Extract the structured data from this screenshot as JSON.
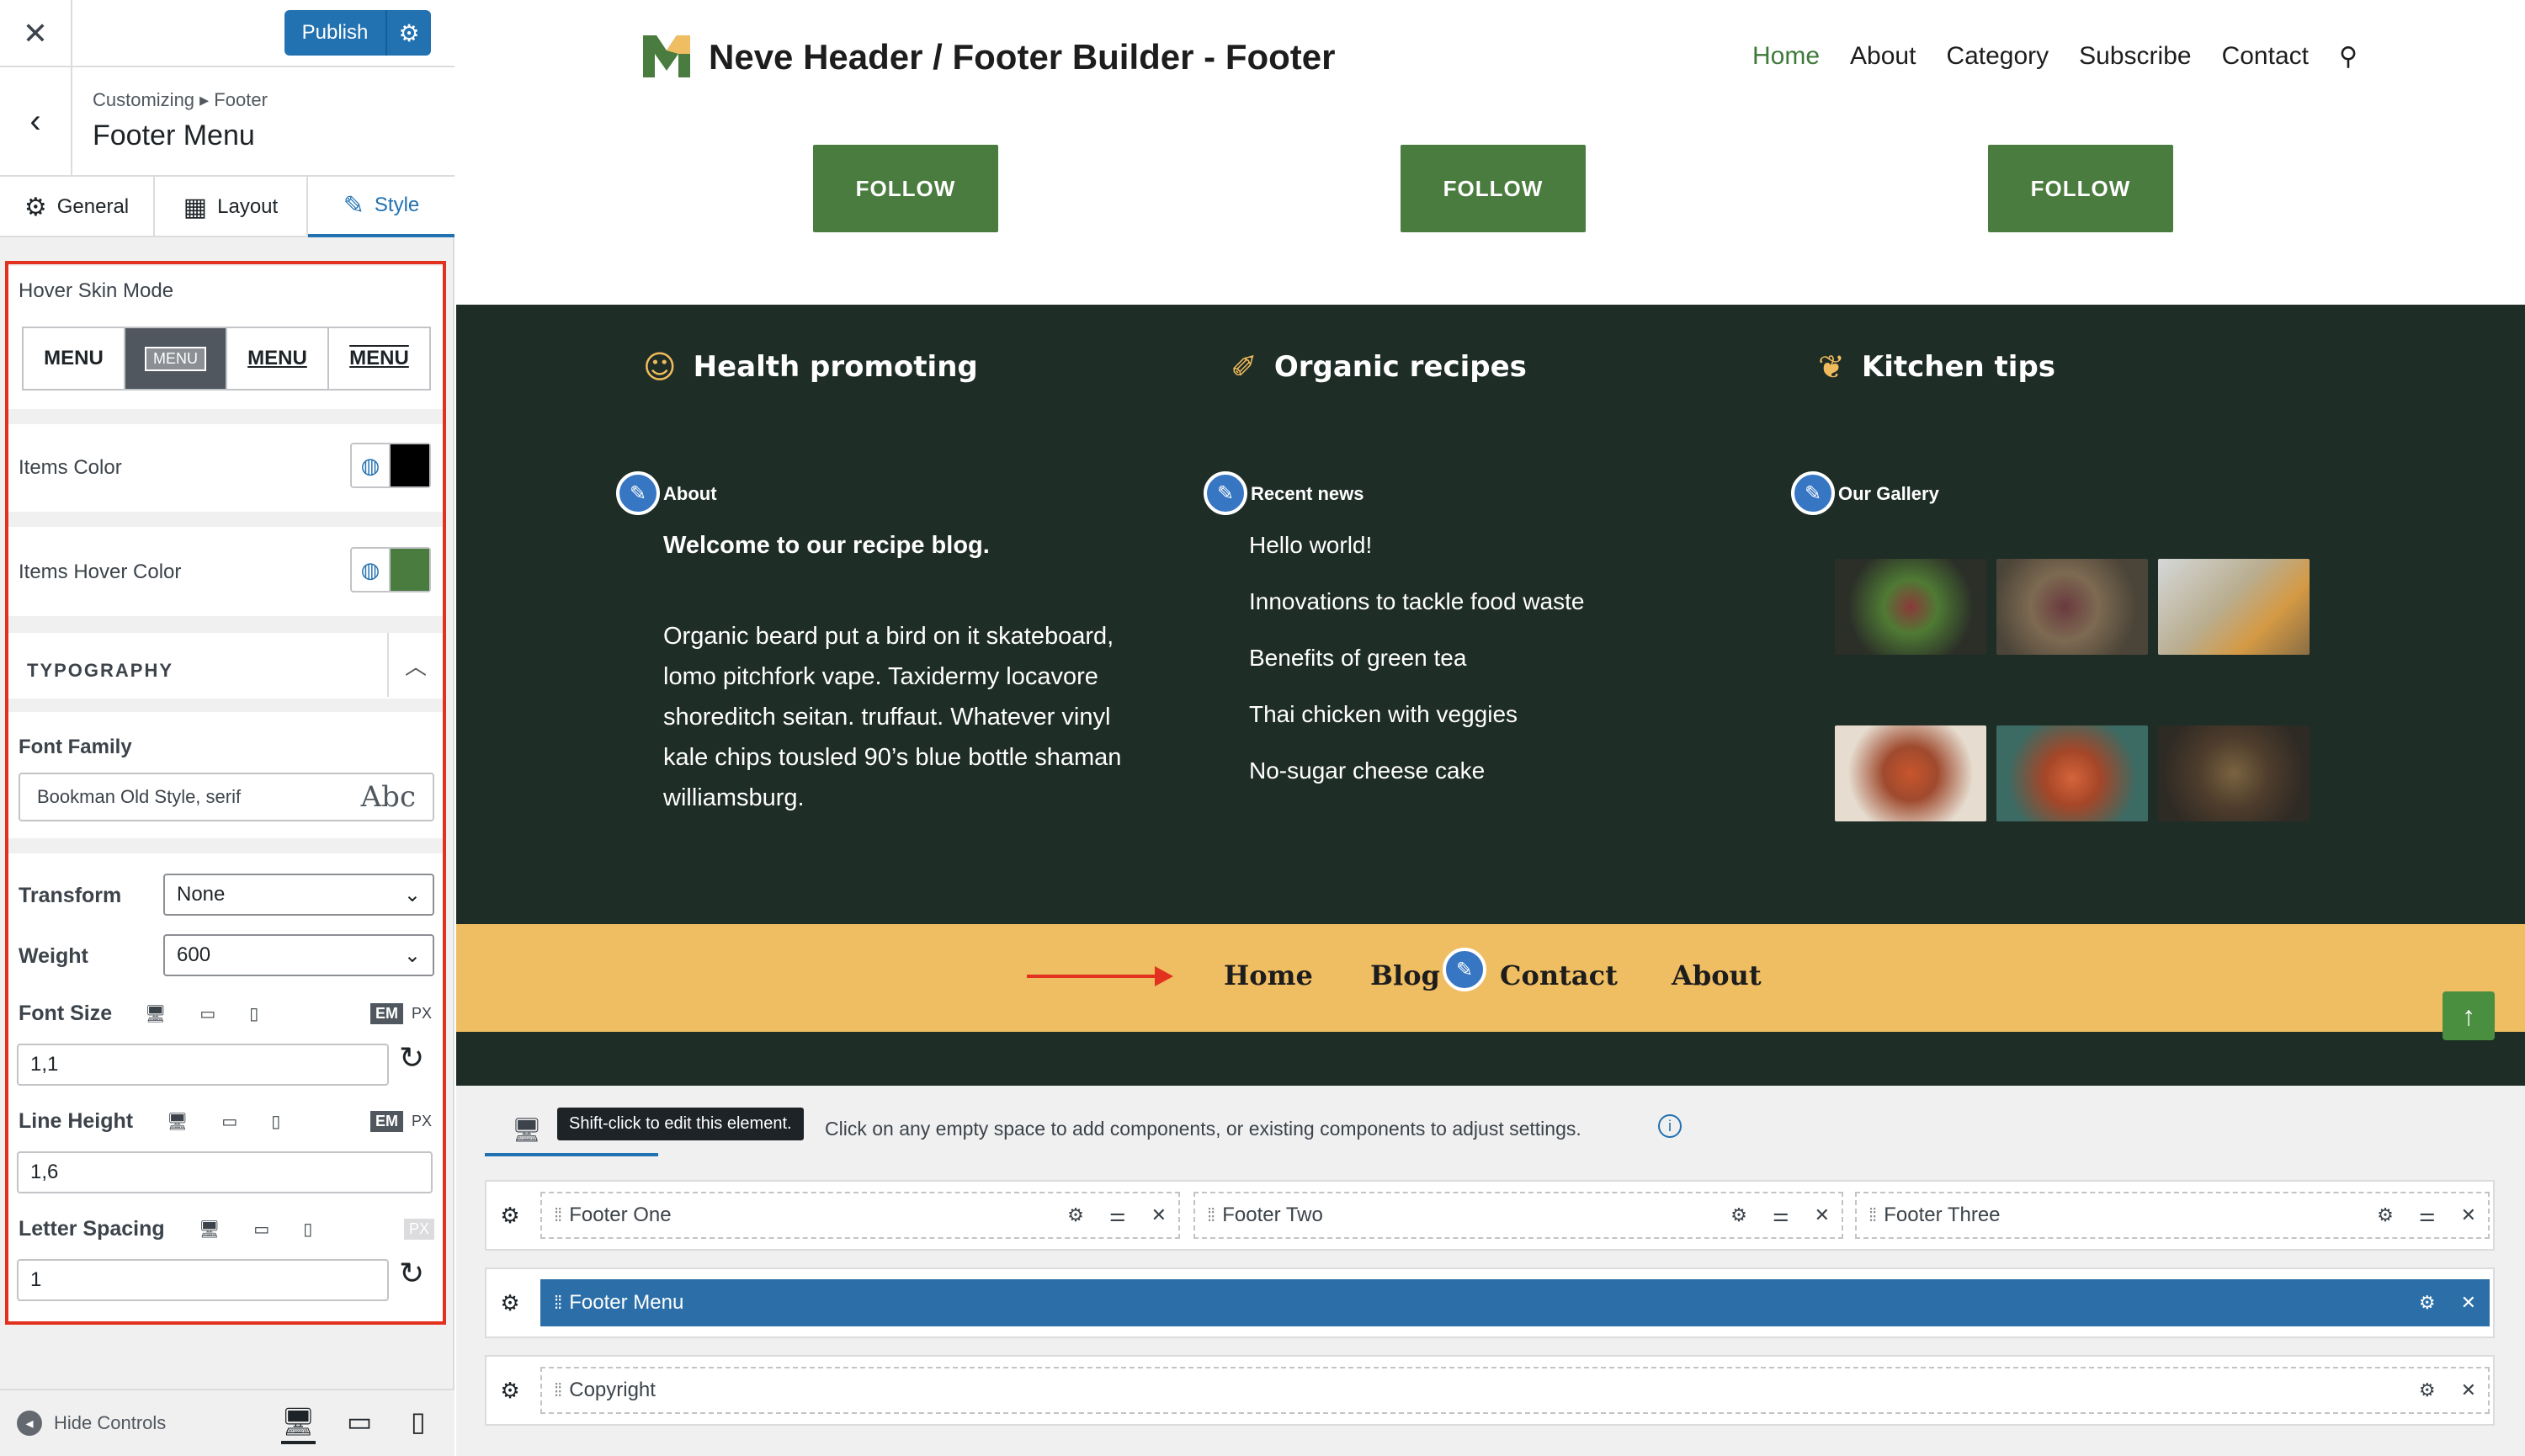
{
  "topbar": {
    "close": "✕",
    "publish_label": "Publish",
    "publish_gear": "⚙"
  },
  "crumb": {
    "path": "Customizing ▸ Footer",
    "title": "Footer Menu",
    "back": "‹"
  },
  "tabs": [
    {
      "icon": "⚙",
      "label": "General"
    },
    {
      "icon": "▦",
      "label": "Layout"
    },
    {
      "icon": "✎",
      "label": "Style"
    }
  ],
  "hover_skin": {
    "label": "Hover Skin Mode",
    "options": [
      "MENU",
      "MENU",
      "MENU",
      "MENU"
    ],
    "selected": 1
  },
  "items_color": {
    "label": "Items Color",
    "value": "#000000"
  },
  "items_hover_color": {
    "label": "Items Hover Color",
    "value": "#4a7c3f"
  },
  "typography": {
    "heading": "TYPOGRAPHY",
    "font_family_label": "Font Family",
    "font_family": "Bookman Old Style, serif",
    "font_preview": "Abc",
    "transform_label": "Transform",
    "transform": "None",
    "weight_label": "Weight",
    "weight": "600",
    "font_size_label": "Font Size",
    "font_size": "1,1",
    "line_height_label": "Line Height",
    "line_height": "1,6",
    "letter_spacing_label": "Letter Spacing",
    "letter_spacing": "1",
    "unit_em": "EM",
    "unit_px": "PX"
  },
  "bottom": {
    "hide_controls": "Hide Controls"
  },
  "site": {
    "title": "Neve Header / Footer Builder - Footer",
    "nav": [
      "Home",
      "About",
      "Category",
      "Subscribe",
      "Contact"
    ],
    "follow": "FOLLOW",
    "features": [
      {
        "icon": "☺",
        "label": "Health promoting"
      },
      {
        "icon": "✐",
        "label": "Organic recipes"
      },
      {
        "icon": "❦",
        "label": "Kitchen tips"
      }
    ],
    "col_about": "About",
    "col_news": "Recent news",
    "col_gallery": "Our Gallery",
    "about_bold": "Welcome to our recipe blog.",
    "about_text": "Organic beard put a bird on it skateboard, lomo pitchfork vape. Taxidermy locavore shoreditch seitan. truffaut. Whatever vinyl kale chips tousled 90’s blue bottle shaman williamsburg.",
    "news": [
      "Hello world!",
      "Innovations to tackle food waste",
      "Benefits of green tea",
      "Thai chicken with veggies",
      "No-sugar cheese cake"
    ],
    "footer_menu": [
      "Home",
      "Blog",
      "Contact",
      "About"
    ],
    "to_top": "↑"
  },
  "builder": {
    "tooltip": "Shift-click to edit this element.",
    "hint": "Click on any empty space to add components, or existing components to adjust settings.",
    "info": "i",
    "components": [
      "Footer One",
      "Footer Two",
      "Footer Three",
      "Footer Menu",
      "Copyright"
    ]
  },
  "colors": {
    "accent": "#2271b1",
    "green": "#4a7c3f",
    "dark": "#1f2d27",
    "yellow": "#efbd62",
    "highlight": "#e2321f"
  }
}
